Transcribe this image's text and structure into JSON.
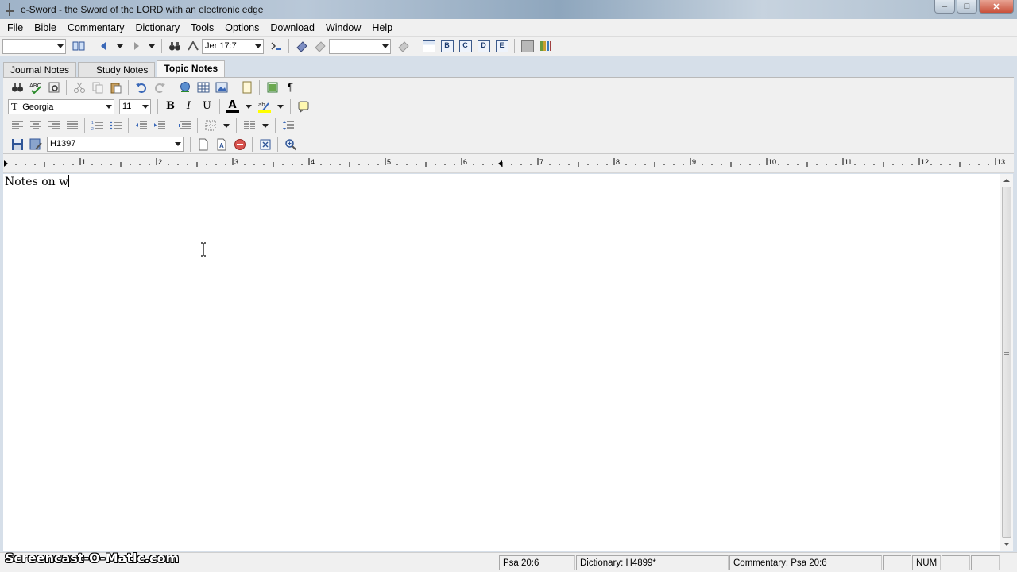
{
  "window": {
    "title": "e-Sword - the Sword of the LORD with an electronic edge",
    "minimize_glyph": "–",
    "maximize_glyph": "□",
    "close_glyph": "✕"
  },
  "menu": {
    "items": [
      "File",
      "Bible",
      "Commentary",
      "Dictionary",
      "Tools",
      "Options",
      "Download",
      "Window",
      "Help"
    ]
  },
  "main_toolbar": {
    "bible_select_value": "",
    "verse_select_value": "Jer 17:7",
    "extra_select_value": "",
    "view_buttons": [
      "B",
      "C",
      "D",
      "E"
    ]
  },
  "tabs": [
    "Journal Notes",
    "Study Notes",
    "Topic Notes"
  ],
  "active_tab": "Topic Notes",
  "format_toolbar": {
    "font_value": "Georgia",
    "size_value": "11",
    "bold": "B",
    "italic": "I",
    "underline": "U",
    "font_color_letter": "A",
    "pilcrow": "¶",
    "font_icon_letter": "T"
  },
  "file_toolbar": {
    "topic_select_value": "H1397"
  },
  "ruler": {
    "numbers": [
      "1",
      "2",
      "3",
      "4",
      "5",
      "6",
      "7",
      "8",
      "9",
      "10",
      "11",
      "12",
      "13"
    ]
  },
  "editor": {
    "text": "Notes on w"
  },
  "status": {
    "cells": [
      "Psa 20:6",
      "Dictionary: H4899*",
      "Commentary: Psa 20:6",
      "",
      "NUM",
      "",
      ""
    ]
  },
  "watermark": "Screencast-O-Matic.com",
  "colors": {
    "accent_blue": "#3a68b8",
    "stop_red": "#d9534f",
    "background": "#f0f0f0"
  }
}
